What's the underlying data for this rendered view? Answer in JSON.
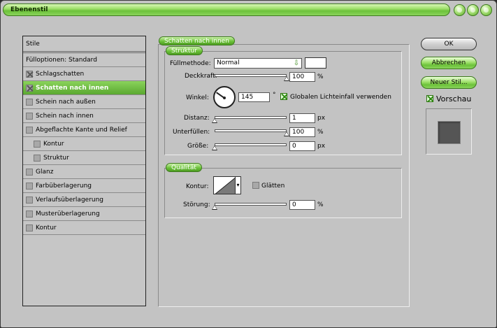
{
  "window": {
    "title": "Ebenenstil"
  },
  "style_list": {
    "header": "Stile",
    "blend_options": "Fülloptionen: Standard",
    "items": [
      {
        "label": "Schlagschatten",
        "checked": true,
        "selected": false,
        "indent": false
      },
      {
        "label": "Schatten nach innen",
        "checked": true,
        "selected": true,
        "indent": false
      },
      {
        "label": "Schein nach außen",
        "checked": false,
        "selected": false,
        "indent": false
      },
      {
        "label": "Schein nach innen",
        "checked": false,
        "selected": false,
        "indent": false
      },
      {
        "label": "Abgeflachte Kante und Relief",
        "checked": false,
        "selected": false,
        "indent": false
      },
      {
        "label": "Kontur",
        "checked": false,
        "selected": false,
        "indent": true
      },
      {
        "label": "Struktur",
        "checked": false,
        "selected": false,
        "indent": true
      },
      {
        "label": "Glanz",
        "checked": false,
        "selected": false,
        "indent": false
      },
      {
        "label": "Farbüberlagerung",
        "checked": false,
        "selected": false,
        "indent": false
      },
      {
        "label": "Verlaufsüberlagerung",
        "checked": false,
        "selected": false,
        "indent": false
      },
      {
        "label": "Musterüberlagerung",
        "checked": false,
        "selected": false,
        "indent": false
      },
      {
        "label": "Kontur",
        "checked": false,
        "selected": false,
        "indent": false
      }
    ]
  },
  "panel": {
    "title": "Schatten nach innen",
    "structure": {
      "title": "Struktur",
      "blend_mode_label": "Füllmethode:",
      "blend_mode_value": "Normal",
      "opacity_label": "Deckkraft:",
      "opacity_value": "100",
      "opacity_unit": "%",
      "opacity_level": 1.0,
      "angle_label": "Winkel:",
      "angle_value": "145",
      "angle_unit": "°",
      "global_light_label": "Globalen Lichteinfall verwenden",
      "global_light_checked": true,
      "distance_label": "Distanz:",
      "distance_value": "1",
      "distance_unit": "px",
      "distance_level": 0.0,
      "choke_label": "Unterfüllen:",
      "choke_value": "100",
      "choke_unit": "%",
      "choke_level": 1.0,
      "size_label": "Größe:",
      "size_value": "0",
      "size_unit": "px",
      "size_level": 0.0
    },
    "quality": {
      "title": "Qualität",
      "contour_label": "Kontur:",
      "antialias_label": "Glätten",
      "antialias_checked": false,
      "noise_label": "Störung:",
      "noise_value": "0",
      "noise_unit": "%",
      "noise_level": 0.0
    }
  },
  "buttons": {
    "ok": "OK",
    "cancel": "Abbrechen",
    "new_style": "Neuer Stil...",
    "preview_label": "Vorschau",
    "preview_checked": true
  },
  "colors": {
    "accent_green": "#6cc23a",
    "window_bg": "#c3c3c3",
    "selected_item": "#5aa830",
    "preview_swatch": "#555555"
  },
  "icons": {
    "blend_arrow": "arrow-down-icon",
    "contour_dropdown": "triangle-down-icon"
  }
}
